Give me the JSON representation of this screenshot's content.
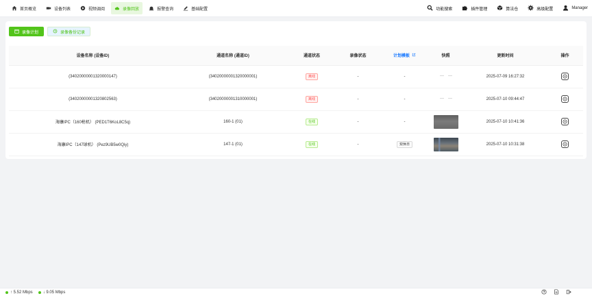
{
  "nav": {
    "items": [
      {
        "label": "首页概览",
        "icon": "home-icon",
        "active": false
      },
      {
        "label": "设备列表",
        "icon": "video-camera-icon",
        "active": false
      },
      {
        "label": "视频调阅",
        "icon": "play-circle-icon",
        "active": false
      },
      {
        "label": "录像回放",
        "icon": "cloud-icon",
        "active": true
      },
      {
        "label": "报警查询",
        "icon": "alarm-icon",
        "active": false
      },
      {
        "label": "基础配置",
        "icon": "edit-icon",
        "active": false
      }
    ],
    "tools": [
      {
        "label": "功能搜索",
        "icon": "search-icon"
      },
      {
        "label": "插件管理",
        "icon": "puzzle-icon"
      },
      {
        "label": "算法仓",
        "icon": "box-icon"
      },
      {
        "label": "高级配置",
        "icon": "gear-icon"
      },
      {
        "label": "Manager",
        "icon": "user-icon"
      }
    ]
  },
  "actions": {
    "plan_label": "录像计划",
    "backup_label": "录像备份记录"
  },
  "table": {
    "columns": [
      "设备名称 (设备ID)",
      "通道名称 (通道ID)",
      "通道状态",
      "录像状态",
      "计划模板",
      "快照",
      "更新时间",
      "操作"
    ],
    "rows": [
      {
        "device": "(34020000001320000147)",
        "channel": "(34020000001320000001)",
        "status": "离线",
        "status_type": "offline",
        "record": "-",
        "template": "-",
        "snapshot": "none",
        "updated": "2025-07-09 16:27:32"
      },
      {
        "device": "(34020000001320802563)",
        "channel": "(34020000001310000001)",
        "status": "离线",
        "status_type": "offline",
        "record": "-",
        "template": "-",
        "snapshot": "none",
        "updated": "2025-07-10 09:44:47"
      },
      {
        "device": "海康IPC（160枪机） (PED1T6KoL8C5q)",
        "channel": "160-1 (01)",
        "status": "在线",
        "status_type": "online",
        "record": "-",
        "template": "-",
        "snapshot": "image-1",
        "updated": "2025-07-10 10:41:36"
      },
      {
        "device": "海康IPC（147球机） (Pez9UB5w0Qiy)",
        "channel": "147-1 (01)",
        "status": "在线",
        "status_type": "online",
        "record": "-",
        "template": "双休日",
        "snapshot": "image-2",
        "updated": "2025-07-10 10:31:38"
      }
    ]
  },
  "status_bar": {
    "upload": "↑ 5.52 Mbps",
    "download": "↓ 9.05 Mbps"
  },
  "colors": {
    "accent": "#52c41a",
    "offline": "#ff4d4f",
    "link": "#1677ff"
  }
}
